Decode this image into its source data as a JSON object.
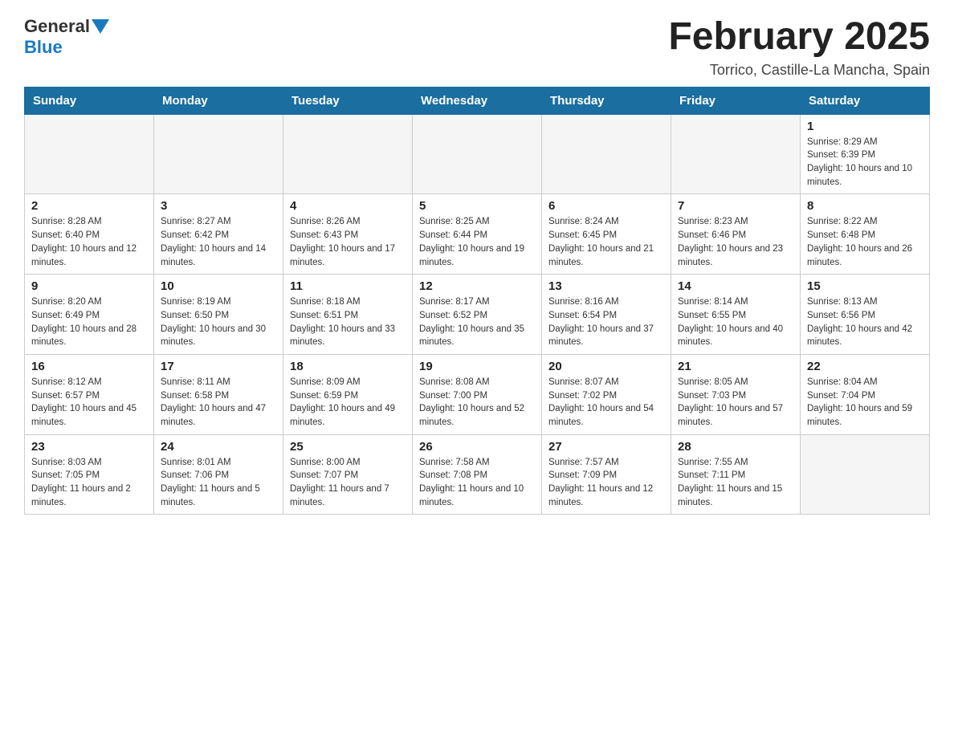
{
  "header": {
    "logo_general": "General",
    "logo_blue": "Blue",
    "title": "February 2025",
    "subtitle": "Torrico, Castille-La Mancha, Spain"
  },
  "days_of_week": [
    "Sunday",
    "Monday",
    "Tuesday",
    "Wednesday",
    "Thursday",
    "Friday",
    "Saturday"
  ],
  "weeks": [
    [
      {
        "day": "",
        "info": ""
      },
      {
        "day": "",
        "info": ""
      },
      {
        "day": "",
        "info": ""
      },
      {
        "day": "",
        "info": ""
      },
      {
        "day": "",
        "info": ""
      },
      {
        "day": "",
        "info": ""
      },
      {
        "day": "1",
        "info": "Sunrise: 8:29 AM\nSunset: 6:39 PM\nDaylight: 10 hours and 10 minutes."
      }
    ],
    [
      {
        "day": "2",
        "info": "Sunrise: 8:28 AM\nSunset: 6:40 PM\nDaylight: 10 hours and 12 minutes."
      },
      {
        "day": "3",
        "info": "Sunrise: 8:27 AM\nSunset: 6:42 PM\nDaylight: 10 hours and 14 minutes."
      },
      {
        "day": "4",
        "info": "Sunrise: 8:26 AM\nSunset: 6:43 PM\nDaylight: 10 hours and 17 minutes."
      },
      {
        "day": "5",
        "info": "Sunrise: 8:25 AM\nSunset: 6:44 PM\nDaylight: 10 hours and 19 minutes."
      },
      {
        "day": "6",
        "info": "Sunrise: 8:24 AM\nSunset: 6:45 PM\nDaylight: 10 hours and 21 minutes."
      },
      {
        "day": "7",
        "info": "Sunrise: 8:23 AM\nSunset: 6:46 PM\nDaylight: 10 hours and 23 minutes."
      },
      {
        "day": "8",
        "info": "Sunrise: 8:22 AM\nSunset: 6:48 PM\nDaylight: 10 hours and 26 minutes."
      }
    ],
    [
      {
        "day": "9",
        "info": "Sunrise: 8:20 AM\nSunset: 6:49 PM\nDaylight: 10 hours and 28 minutes."
      },
      {
        "day": "10",
        "info": "Sunrise: 8:19 AM\nSunset: 6:50 PM\nDaylight: 10 hours and 30 minutes."
      },
      {
        "day": "11",
        "info": "Sunrise: 8:18 AM\nSunset: 6:51 PM\nDaylight: 10 hours and 33 minutes."
      },
      {
        "day": "12",
        "info": "Sunrise: 8:17 AM\nSunset: 6:52 PM\nDaylight: 10 hours and 35 minutes."
      },
      {
        "day": "13",
        "info": "Sunrise: 8:16 AM\nSunset: 6:54 PM\nDaylight: 10 hours and 37 minutes."
      },
      {
        "day": "14",
        "info": "Sunrise: 8:14 AM\nSunset: 6:55 PM\nDaylight: 10 hours and 40 minutes."
      },
      {
        "day": "15",
        "info": "Sunrise: 8:13 AM\nSunset: 6:56 PM\nDaylight: 10 hours and 42 minutes."
      }
    ],
    [
      {
        "day": "16",
        "info": "Sunrise: 8:12 AM\nSunset: 6:57 PM\nDaylight: 10 hours and 45 minutes."
      },
      {
        "day": "17",
        "info": "Sunrise: 8:11 AM\nSunset: 6:58 PM\nDaylight: 10 hours and 47 minutes."
      },
      {
        "day": "18",
        "info": "Sunrise: 8:09 AM\nSunset: 6:59 PM\nDaylight: 10 hours and 49 minutes."
      },
      {
        "day": "19",
        "info": "Sunrise: 8:08 AM\nSunset: 7:00 PM\nDaylight: 10 hours and 52 minutes."
      },
      {
        "day": "20",
        "info": "Sunrise: 8:07 AM\nSunset: 7:02 PM\nDaylight: 10 hours and 54 minutes."
      },
      {
        "day": "21",
        "info": "Sunrise: 8:05 AM\nSunset: 7:03 PM\nDaylight: 10 hours and 57 minutes."
      },
      {
        "day": "22",
        "info": "Sunrise: 8:04 AM\nSunset: 7:04 PM\nDaylight: 10 hours and 59 minutes."
      }
    ],
    [
      {
        "day": "23",
        "info": "Sunrise: 8:03 AM\nSunset: 7:05 PM\nDaylight: 11 hours and 2 minutes."
      },
      {
        "day": "24",
        "info": "Sunrise: 8:01 AM\nSunset: 7:06 PM\nDaylight: 11 hours and 5 minutes."
      },
      {
        "day": "25",
        "info": "Sunrise: 8:00 AM\nSunset: 7:07 PM\nDaylight: 11 hours and 7 minutes."
      },
      {
        "day": "26",
        "info": "Sunrise: 7:58 AM\nSunset: 7:08 PM\nDaylight: 11 hours and 10 minutes."
      },
      {
        "day": "27",
        "info": "Sunrise: 7:57 AM\nSunset: 7:09 PM\nDaylight: 11 hours and 12 minutes."
      },
      {
        "day": "28",
        "info": "Sunrise: 7:55 AM\nSunset: 7:11 PM\nDaylight: 11 hours and 15 minutes."
      },
      {
        "day": "",
        "info": ""
      }
    ]
  ]
}
